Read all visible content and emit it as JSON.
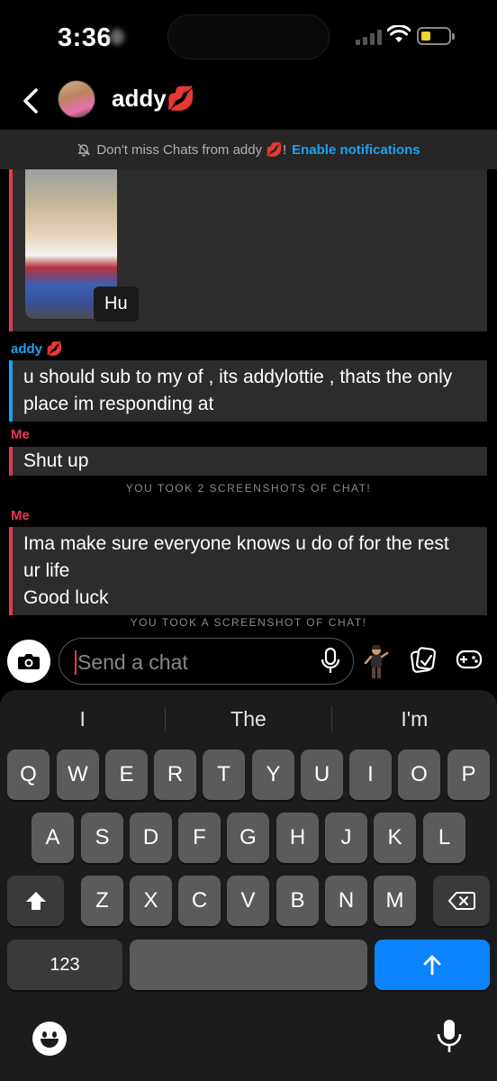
{
  "status_bar": {
    "time": "3:36"
  },
  "header": {
    "contact_name": "addy",
    "contact_emoji": "💋"
  },
  "notification": {
    "text": "Don't miss Chats from addy 💋!",
    "link": "Enable notifications"
  },
  "messages": [
    {
      "type": "snap",
      "from": "addy",
      "caption": "Hu"
    },
    {
      "type": "text",
      "sender_label": "addy 💋",
      "text_lines": [
        "u should sub to my of , its addylottie  , thats the only",
        "place im responding at"
      ]
    },
    {
      "type": "text",
      "sender_label": "Me",
      "text_lines": [
        "Shut up"
      ]
    },
    {
      "type": "system",
      "text": "YOU TOOK 2 SCREENSHOTS OF CHAT!"
    },
    {
      "type": "text",
      "sender_label": "Me",
      "text_lines": [
        "Ima make sure everyone knows u do of for the rest",
        "ur life",
        "Good luck"
      ]
    },
    {
      "type": "system",
      "text": "YOU TOOK A SCREENSHOT OF CHAT!"
    }
  ],
  "input": {
    "placeholder": "Send a chat"
  },
  "keyboard": {
    "suggestions": [
      "I",
      "The",
      "I'm"
    ],
    "row1": [
      "Q",
      "W",
      "E",
      "R",
      "T",
      "Y",
      "U",
      "I",
      "O",
      "P"
    ],
    "row2": [
      "A",
      "S",
      "D",
      "F",
      "G",
      "H",
      "J",
      "K",
      "L"
    ],
    "row3": [
      "Z",
      "X",
      "C",
      "V",
      "B",
      "N",
      "M"
    ],
    "numbers_label": "123"
  },
  "colors": {
    "me": "#e3384f",
    "them": "#1da1f2",
    "send": "#0a84ff"
  }
}
